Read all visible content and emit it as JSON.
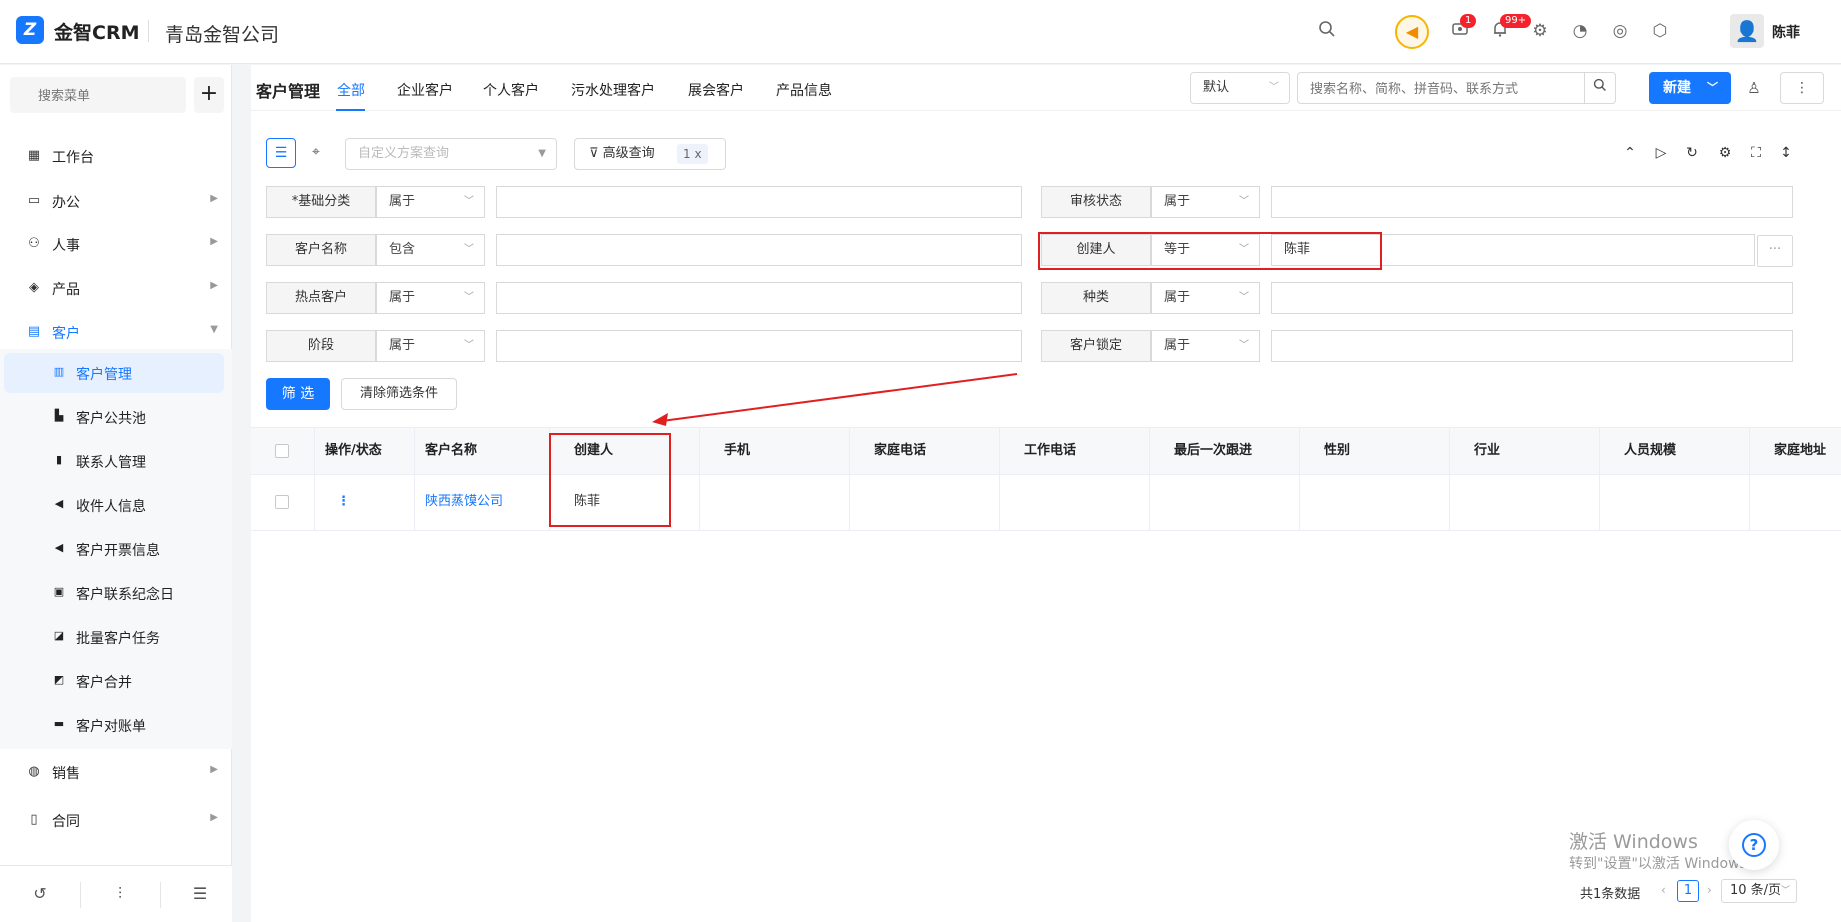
{
  "header": {
    "app_name": "金智CRM",
    "company": "青岛金智公司",
    "user_name": "陈菲",
    "message_badge": "1",
    "notification_badge": "99+"
  },
  "sidebar": {
    "search_placeholder": "搜索菜单",
    "items": [
      {
        "label": "工作台",
        "icon": "dashboard-icon"
      },
      {
        "label": "办公",
        "icon": "monitor-icon"
      },
      {
        "label": "人事",
        "icon": "people-icon"
      },
      {
        "label": "产品",
        "icon": "box-icon"
      },
      {
        "label": "客户",
        "icon": "customer-icon"
      },
      {
        "label": "销售",
        "icon": "sales-icon"
      },
      {
        "label": "合同",
        "icon": "contract-icon"
      }
    ],
    "sub_items": [
      {
        "label": "客户管理"
      },
      {
        "label": "客户公共池"
      },
      {
        "label": "联系人管理"
      },
      {
        "label": "收件人信息"
      },
      {
        "label": "客户开票信息"
      },
      {
        "label": "客户联系纪念日"
      },
      {
        "label": "批量客户任务"
      },
      {
        "label": "客户合并"
      },
      {
        "label": "客户对账单"
      }
    ]
  },
  "main": {
    "page_title": "客户管理",
    "tabs": [
      {
        "label": "全部"
      },
      {
        "label": "企业客户"
      },
      {
        "label": "个人客户"
      },
      {
        "label": "污水处理客户"
      },
      {
        "label": "展会客户"
      },
      {
        "label": "产品信息"
      }
    ],
    "view_select": "默认",
    "search_placeholder": "搜索名称、简称、拼音码、联系方式",
    "new_button": "新建",
    "scheme_placeholder": "自定义方案查询",
    "advanced_query": "高级查询",
    "advanced_count": "1 x",
    "conditions_left": [
      {
        "label": "*基础分类",
        "op": "属于",
        "value": ""
      },
      {
        "label": "客户名称",
        "op": "包含",
        "value": ""
      },
      {
        "label": "热点客户",
        "op": "属于",
        "value": ""
      },
      {
        "label": "阶段",
        "op": "属于",
        "value": ""
      }
    ],
    "conditions_right": [
      {
        "label": "审核状态",
        "op": "属于",
        "value": ""
      },
      {
        "label": "创建人",
        "op": "等于",
        "value": "陈菲"
      },
      {
        "label": "种类",
        "op": "属于",
        "value": ""
      },
      {
        "label": "客户锁定",
        "op": "属于",
        "value": ""
      }
    ],
    "more_button": "···",
    "filter_button": "筛 选",
    "clear_button": "清除筛选条件"
  },
  "table": {
    "columns": [
      "操作/状态",
      "客户名称",
      "创建人",
      "手机",
      "家庭电话",
      "工作电话",
      "最后一次跟进",
      "性别",
      "行业",
      "人员规模",
      "家庭地址"
    ],
    "rows": [
      {
        "action": "⋮",
        "name": "陕西蒸馍公司",
        "creator": "陈菲",
        "mobile": "",
        "home_phone": "",
        "work_phone": "",
        "last_follow": "",
        "gender": "",
        "industry": "",
        "staff_size": "",
        "home_address": ""
      }
    ]
  },
  "pagination": {
    "total": "共1条数据",
    "current_page": "1",
    "page_size": "10 条/页"
  },
  "watermark": {
    "line1": "激活 Windows",
    "line2": "转到\"设置\"以激活 Windows。"
  },
  "colors": {
    "accent": "#1677ff",
    "highlight": "#e02020"
  }
}
